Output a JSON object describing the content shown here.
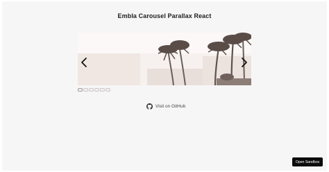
{
  "header": {
    "title": "Embla Carousel Parallax React"
  },
  "carousel": {
    "slide_image": "palm-trees-photo",
    "prev_icon": "chevron-left-icon",
    "next_icon": "chevron-right-icon",
    "dots_count": 6,
    "selected_dot": 1
  },
  "footer": {
    "github_label": "Visit on GitHub",
    "github_icon": "github-icon"
  },
  "sandbox": {
    "label": "Open Sandbox"
  },
  "colors": {
    "background": "#f7f6f6",
    "button": "#0b0b0b",
    "sky": "#efe7e3"
  }
}
